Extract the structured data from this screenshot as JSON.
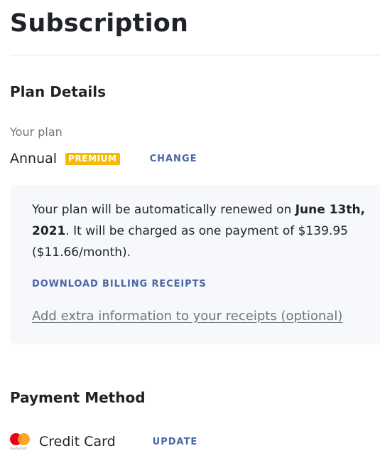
{
  "page": {
    "title": "Subscription"
  },
  "plan_details": {
    "heading": "Plan Details",
    "your_plan_label": "Your plan",
    "plan_name": "Annual",
    "badge": "PREMIUM",
    "change_label": "CHANGE"
  },
  "renewal": {
    "text_before": "Your plan will be automatically renewed on ",
    "renewal_date": "June 13th, 2021",
    "text_after": ". It will be charged as one payment of $139.95 ($11.66/month).",
    "download_label": "DOWNLOAD BILLING RECEIPTS",
    "extra_info_label": "Add extra information to your receipts (optional)"
  },
  "payment": {
    "heading": "Payment Method",
    "card_label": "Credit Card",
    "card_brand_icon": "mastercard-icon",
    "card_brand_text": "mastercard",
    "update_label": "UPDATE"
  },
  "colors": {
    "accent_link": "#4a66a6",
    "premium_badge": "#f5b90a",
    "box_background": "#f6f8fb",
    "muted_text": "#6e7681",
    "mastercard_red": "#eb001b",
    "mastercard_orange": "#f79e1b"
  }
}
